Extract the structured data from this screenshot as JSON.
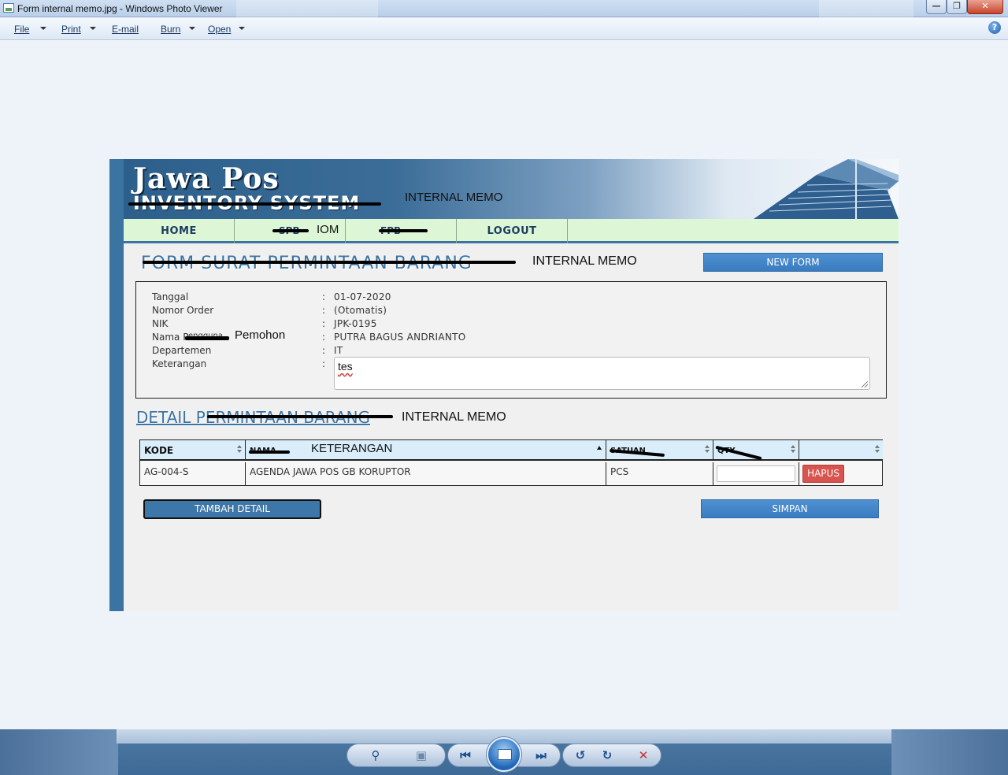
{
  "window": {
    "title": "Form internal memo.jpg - Windows Photo Viewer",
    "controls": {
      "minimize": "—",
      "maximize": "❐",
      "close": "✕"
    }
  },
  "menubar": {
    "items": [
      {
        "label": "File",
        "has_dropdown": true
      },
      {
        "label": "Print",
        "has_dropdown": true
      },
      {
        "label": "E-mail",
        "has_dropdown": false
      },
      {
        "label": "Burn",
        "has_dropdown": true
      },
      {
        "label": "Open",
        "has_dropdown": true
      }
    ],
    "help_icon": "?"
  },
  "page": {
    "banner": {
      "logo_main": "Jawa  Pos",
      "logo_sub": "INVENTORY SYSTEM",
      "label": "INTERNAL MEMO"
    },
    "nav": {
      "home": "HOME",
      "spb_struck": "SPB",
      "spb_replacement": "IOM",
      "fpb_struck": "FPB",
      "logout": "LOGOUT"
    },
    "form": {
      "title": "FORM SURAT PERMINTAAN BARANG",
      "title_replacement": "INTERNAL MEMO",
      "new_form_button": "NEW FORM",
      "fields": {
        "tanggal_label": "Tanggal",
        "tanggal_value": "01-07-2020",
        "nomor_label": "Nomor Order",
        "nomor_value": "(Otomatis)",
        "nik_label": "NIK",
        "nik_value": "JPK-0195",
        "nama_label": "Nama P",
        "nama_struck": "engguna",
        "nama_replacement": "Pemohon",
        "nama_value": "PUTRA BAGUS ANDRIANTO",
        "departemen_label": "Departemen",
        "departemen_value": "IT",
        "keterangan_label": "Keterangan",
        "keterangan_value": "tes",
        "colon": ":"
      }
    },
    "detail": {
      "title": "DETAIL PERMINTAAN BARANG",
      "title_replacement": "INTERNAL MEMO",
      "columns": {
        "kode": "KODE",
        "nama_struck": "NAMA",
        "nama_replacement": "KETERANGAN",
        "satuan_struck": "SATUAN",
        "qty_struck": "QTY"
      },
      "rows": [
        {
          "kode": "AG-004-S",
          "nama": "AGENDA JAWA POS GB KORUPTOR",
          "satuan": "PCS",
          "qty": "",
          "action": "HAPUS"
        }
      ],
      "tambah_button": "TAMBAH DETAIL",
      "simpan_button": "SIMPAN"
    }
  },
  "bottom_toolbar": {
    "zoom_icon": "⚲",
    "actual_size_icon": "▣",
    "prev_icon": "⏮",
    "next_icon": "⏭",
    "rotate_ccw_icon": "↺",
    "rotate_cw_icon": "↻",
    "delete_icon": "✕"
  }
}
